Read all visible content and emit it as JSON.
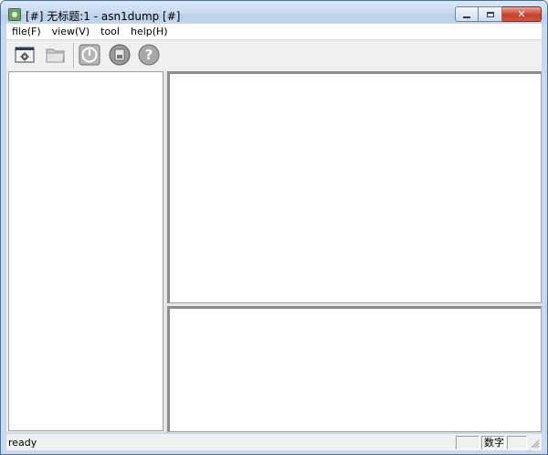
{
  "window": {
    "title": "[#] 无标题:1 - asn1dump [#]",
    "controls": {
      "close_glyph": "✕"
    }
  },
  "menu": [
    {
      "label": "file(F)"
    },
    {
      "label": "view(V)"
    },
    {
      "label": "tool"
    },
    {
      "label": "help(H)"
    }
  ],
  "toolbar": {
    "buttons": [
      {
        "icon": "settings-window-icon"
      },
      {
        "icon": "folder-open-icon"
      },
      {
        "icon": "power-icon"
      },
      {
        "icon": "disk-icon"
      },
      {
        "icon": "help-icon"
      }
    ]
  },
  "status": {
    "text": "ready",
    "cells": [
      "",
      "数字",
      ""
    ]
  }
}
